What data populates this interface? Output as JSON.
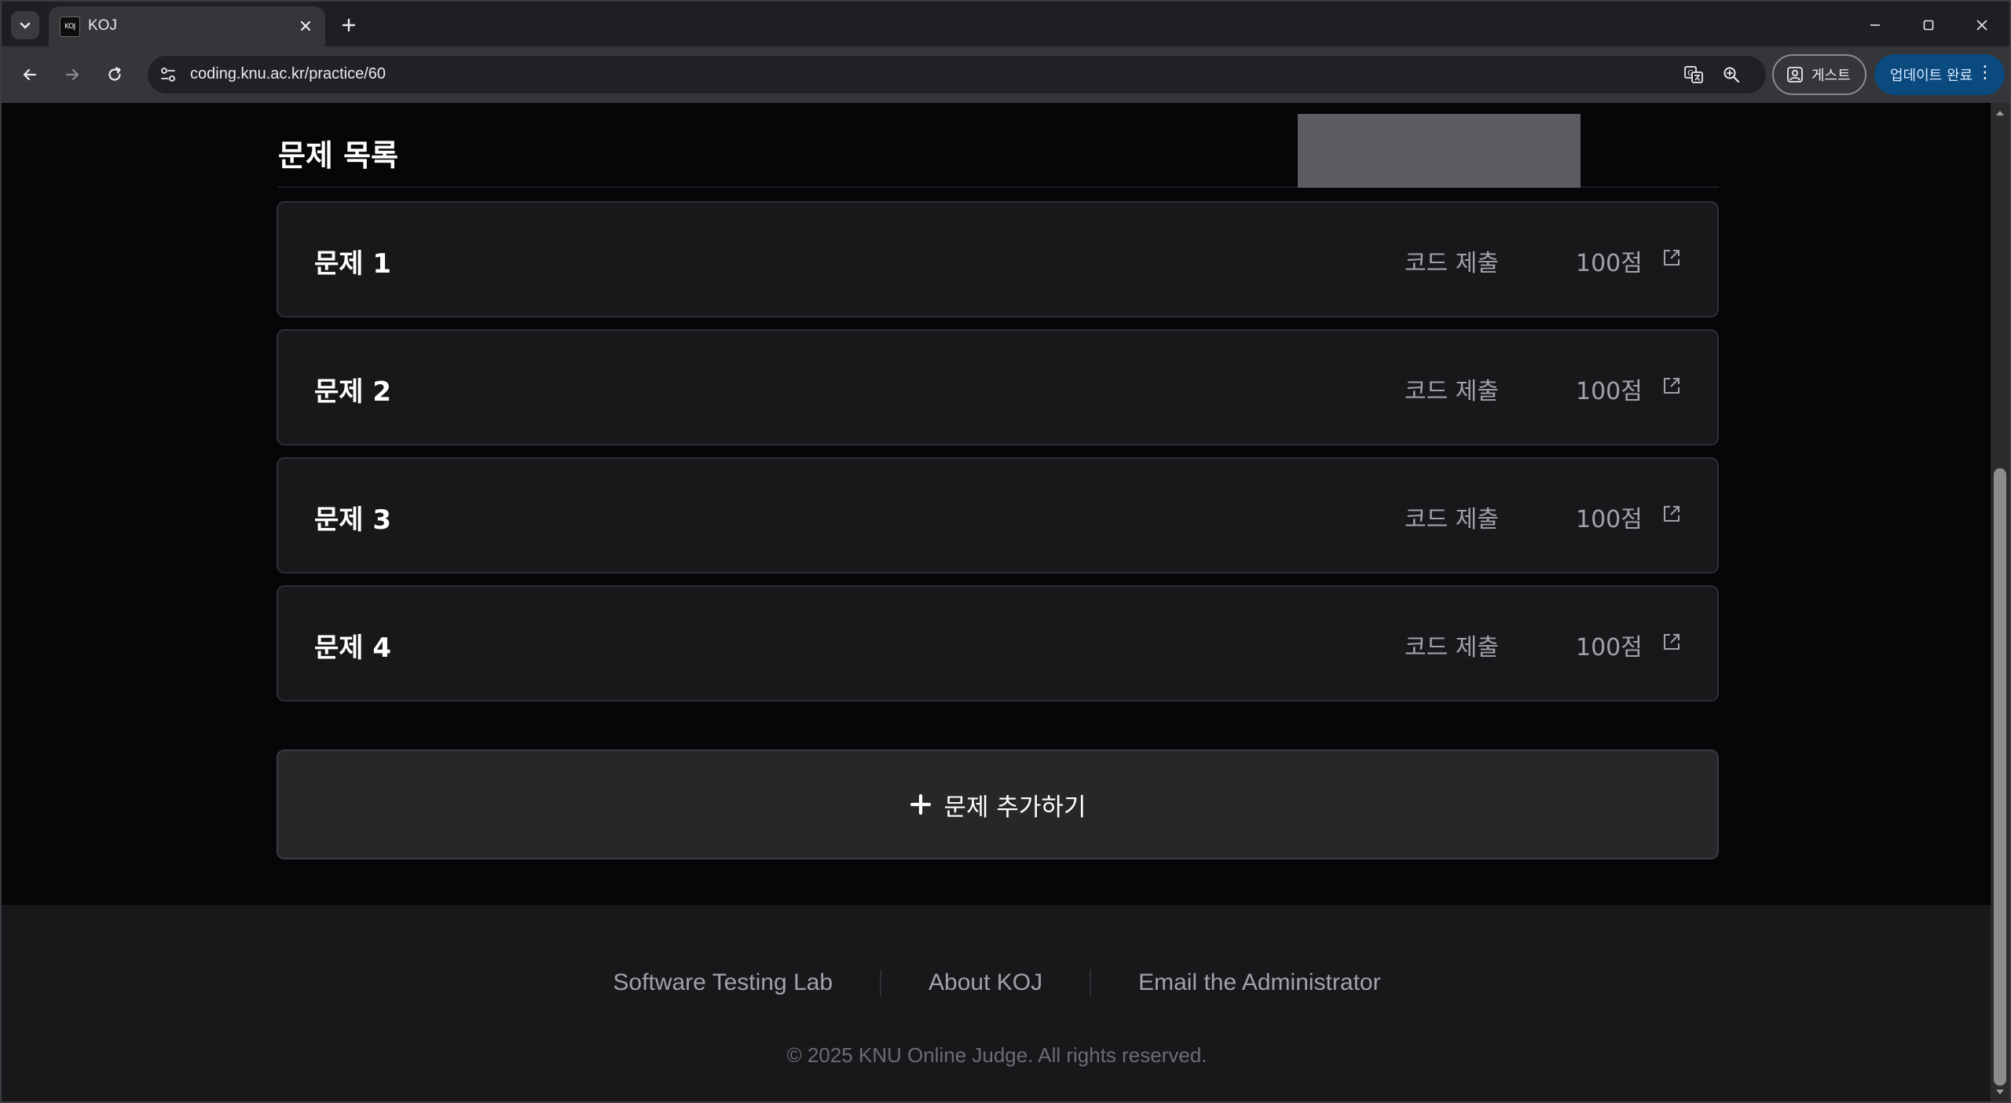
{
  "browser": {
    "tab_title": "KOJ",
    "favicon_text": "KOJ",
    "url": "coding.knu.ac.kr/practice/60",
    "guest_label": "게스트",
    "update_label": "업데이트 완료"
  },
  "page": {
    "section_title": "문제 목록",
    "problems": [
      {
        "name": "문제 1",
        "status": "코드 제출",
        "score": "100점"
      },
      {
        "name": "문제 2",
        "status": "코드 제출",
        "score": "100점"
      },
      {
        "name": "문제 3",
        "status": "코드 제출",
        "score": "100점"
      },
      {
        "name": "문제 4",
        "status": "코드 제출",
        "score": "100점"
      }
    ],
    "add_problem_label": "문제 추가하기"
  },
  "footer": {
    "links": [
      "Software Testing Lab",
      "About KOJ",
      "Email the Administrator"
    ],
    "copyright": "© 2025 KNU Online Judge. All rights reserved."
  },
  "colors": {
    "background": "#060608",
    "card": "#18181b",
    "add_button": "#27272a",
    "muted_text": "#a1a1aa",
    "update_button": "#0b4a7e"
  }
}
